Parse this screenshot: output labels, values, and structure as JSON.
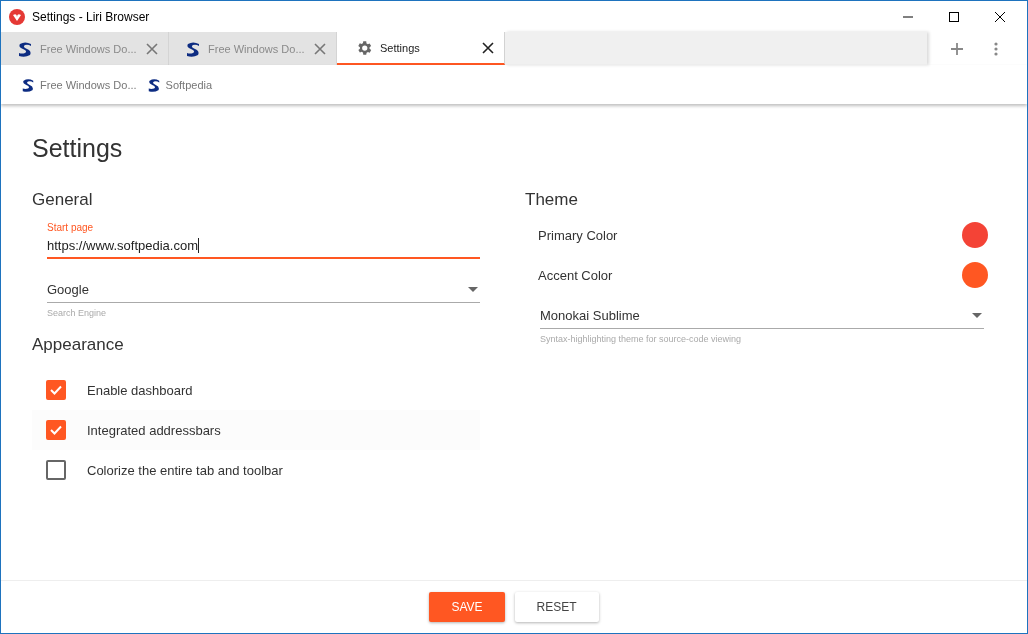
{
  "window": {
    "title": "Settings - Liri Browser"
  },
  "tabs": [
    {
      "title": "Free Windows Do...",
      "kind": "site",
      "selected": false
    },
    {
      "title": "Free Windows Do...",
      "kind": "site",
      "selected": false
    },
    {
      "title": "Settings",
      "kind": "settings",
      "selected": true
    }
  ],
  "bookmarks": [
    {
      "title": "Free Windows Do..."
    },
    {
      "title": "Softpedia"
    }
  ],
  "page_title": "Settings",
  "general": {
    "heading": "General",
    "start_page": {
      "label": "Start page",
      "value": "https://www.softpedia.com",
      "focused": true
    },
    "search_engine": {
      "value": "Google",
      "helper": "Search Engine"
    }
  },
  "appearance": {
    "heading": "Appearance",
    "options": [
      {
        "label": "Enable dashboard",
        "checked": true
      },
      {
        "label": "Integrated addressbars",
        "checked": true
      },
      {
        "label": "Colorize the entire tab and toolbar",
        "checked": false
      }
    ]
  },
  "theme": {
    "heading": "Theme",
    "colors": [
      {
        "label": "Primary Color",
        "color": "#f44336"
      },
      {
        "label": "Accent Color",
        "color": "#ff5722"
      }
    ],
    "syntax": {
      "value": "Monokai Sublime",
      "helper": "Syntax-highlighting theme for source-code viewing"
    }
  },
  "buttons": [
    {
      "label": "SAVE",
      "kind": "primary"
    },
    {
      "label": "RESET",
      "kind": "secondary"
    }
  ]
}
